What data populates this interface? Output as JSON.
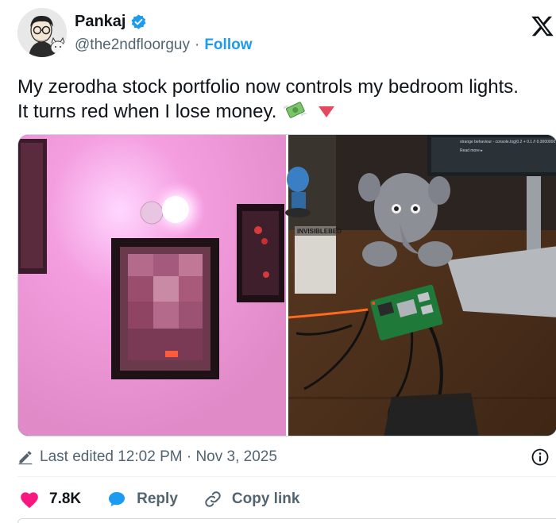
{
  "author": {
    "display_name": "Pankaj",
    "handle": "@the2ndfloorguy",
    "separator": "·",
    "follow_label": "Follow",
    "verified_color": "#1d9bf0"
  },
  "tweet": {
    "text_line1": "My zerodha stock portfolio now controls my bedroom lights.",
    "text_line2": "It turns red when I lose money."
  },
  "media": {
    "image1": "pink-lit-wall-with-bulb-and-frames",
    "image2": "raspberry-pi-on-desk-with-plush-elephant",
    "monitor_text_1": "strange behaviour - console.log(0.2 + 0.1 // 0.3000000",
    "monitor_text_2": "Read more ▸",
    "box_text": "INVISIBLEBED"
  },
  "meta": {
    "edited_label": "Last edited 12:02 PM · Nov 3, 2025"
  },
  "actions": {
    "likes": "7.8K",
    "reply_label": "Reply",
    "copy_link_label": "Copy link",
    "like_color": "#f91880",
    "reply_color": "#1d9bf0"
  }
}
